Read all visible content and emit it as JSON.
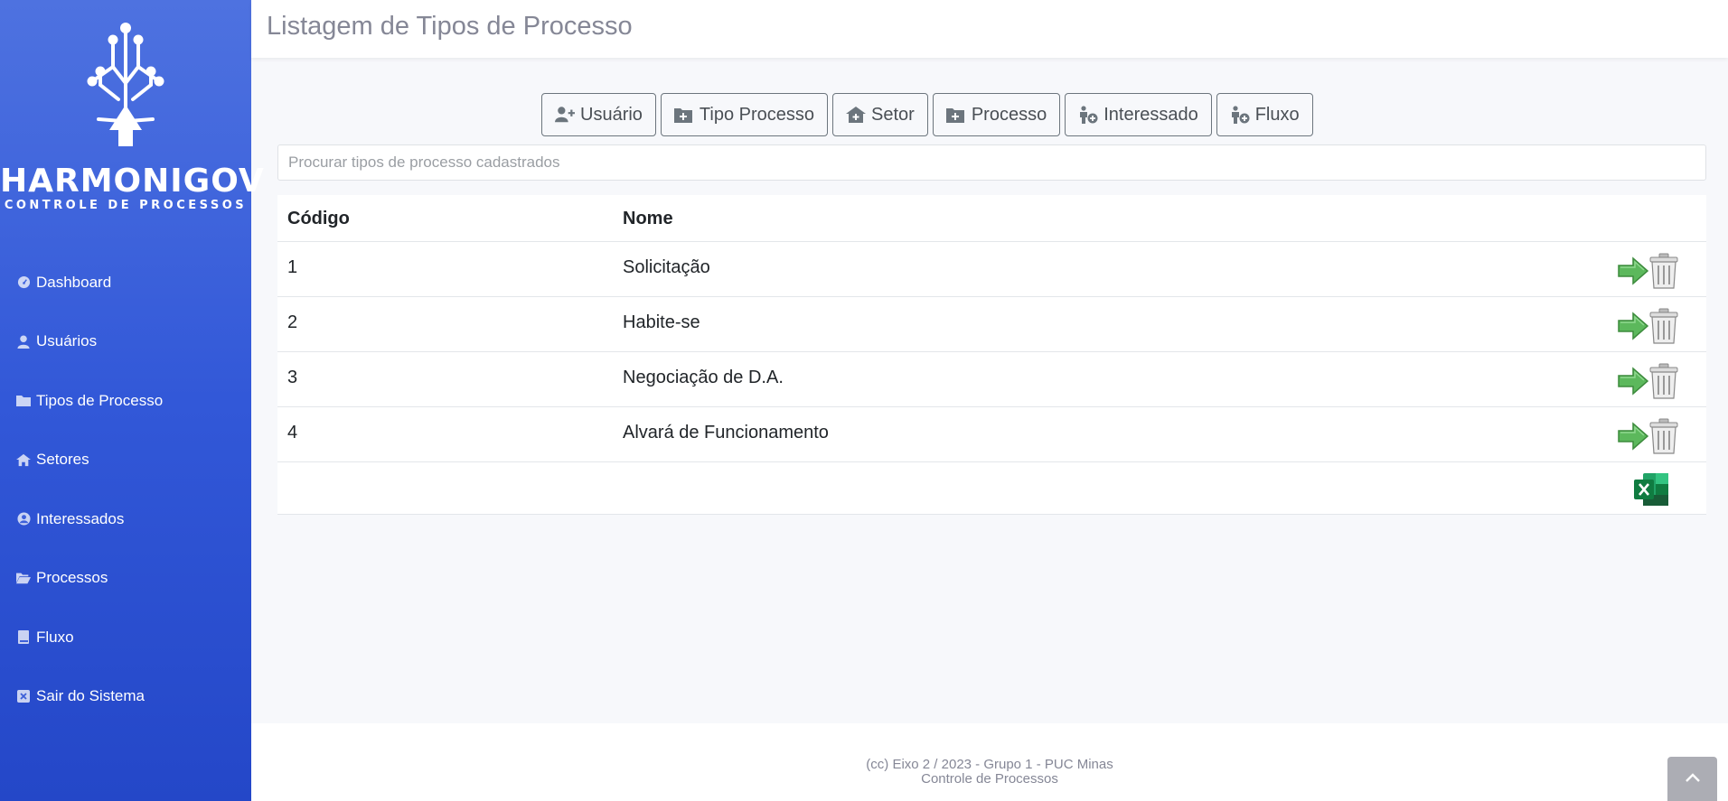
{
  "brand": {
    "title": "HARMONIGOV",
    "subtitle": "CONTROLE DE PROCESSOS"
  },
  "sidebar": {
    "items": [
      {
        "label": "Dashboard",
        "icon": "dashboard-icon"
      },
      {
        "label": "Usuários",
        "icon": "user-icon"
      },
      {
        "label": "Tipos de Processo",
        "icon": "folder-icon"
      },
      {
        "label": "Setores",
        "icon": "home-icon"
      },
      {
        "label": "Interessados",
        "icon": "user-circle-icon"
      },
      {
        "label": "Processos",
        "icon": "folder-open-icon"
      },
      {
        "label": "Fluxo",
        "icon": "book-icon"
      },
      {
        "label": "Sair do Sistema",
        "icon": "close-box-icon"
      }
    ]
  },
  "header": {
    "title": "Listagem de Tipos de Processo"
  },
  "toolbar": {
    "buttons": [
      {
        "label": "Usuário",
        "icon": "user-plus-icon"
      },
      {
        "label": "Tipo Processo",
        "icon": "folder-plus-icon"
      },
      {
        "label": "Setor",
        "icon": "house-plus-icon"
      },
      {
        "label": "Processo",
        "icon": "folder-plus-icon"
      },
      {
        "label": "Interessado",
        "icon": "person-plus-icon"
      },
      {
        "label": "Fluxo",
        "icon": "person-plus-icon"
      }
    ]
  },
  "search": {
    "placeholder": "Procurar tipos de processo cadastrados",
    "value": ""
  },
  "table": {
    "headers": [
      "Código",
      "Nome"
    ],
    "rows": [
      {
        "codigo": "1",
        "nome": "Solicitação"
      },
      {
        "codigo": "2",
        "nome": "Habite-se"
      },
      {
        "codigo": "3",
        "nome": "Negociação de D.A."
      },
      {
        "codigo": "4",
        "nome": "Alvará de Funcionamento"
      }
    ]
  },
  "footer": {
    "line1": "(cc) Eixo 2 / 2023 - Grupo 1 - PUC Minas",
    "line2": "Controle de Processos"
  },
  "colors": {
    "sidebar_top": "#4e72e0",
    "sidebar_bottom": "#2447c8",
    "action_green": "#4caf50",
    "excel_green": "#1d6f42"
  }
}
